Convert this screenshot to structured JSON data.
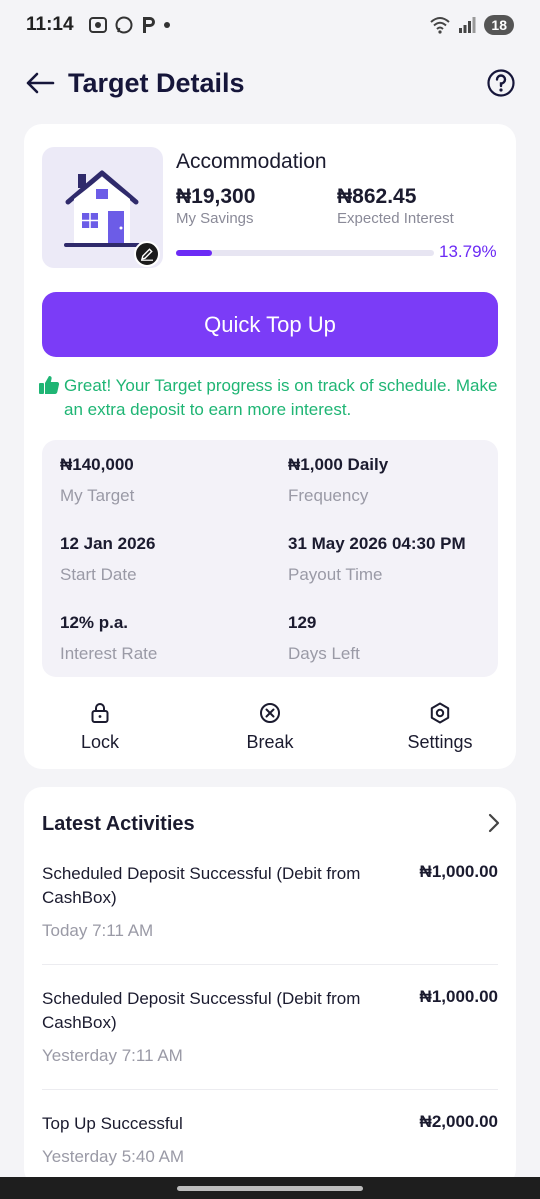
{
  "status_bar": {
    "time": "11:14",
    "battery": "18"
  },
  "header": {
    "title": "Target Details"
  },
  "target": {
    "name": "Accommodation",
    "savings": "₦19,300",
    "savings_label": "My Savings",
    "interest": "₦862.45",
    "interest_label": "Expected Interest",
    "progress_percent": "13.79%",
    "progress_value": 13.79
  },
  "quick_top_up_label": "Quick Top Up",
  "track_message": "Great! Your Target progress is on track of schedule. Make an extra deposit to earn more interest.",
  "details": {
    "target": {
      "value": "₦140,000",
      "label": "My Target"
    },
    "frequency": {
      "value": "₦1,000 Daily",
      "label": "Frequency"
    },
    "start_date": {
      "value": "12 Jan 2026",
      "label": "Start Date"
    },
    "payout_time": {
      "value": "31 May 2026 04:30 PM",
      "label": "Payout Time"
    },
    "interest_rate": {
      "value": "12% p.a.",
      "label": "Interest Rate"
    },
    "days_left": {
      "value": "129",
      "label": "Days Left"
    }
  },
  "actions": {
    "lock": "Lock",
    "break": "Break",
    "settings": "Settings"
  },
  "activities": {
    "title": "Latest Activities",
    "items": [
      {
        "desc": "Scheduled Deposit Successful (Debit from CashBox)",
        "amount": "₦1,000.00",
        "time": "Today 7:11 AM"
      },
      {
        "desc": "Scheduled Deposit Successful (Debit from CashBox)",
        "amount": "₦1,000.00",
        "time": "Yesterday 7:11 AM"
      },
      {
        "desc": "Top Up Successful",
        "amount": "₦2,000.00",
        "time": "Yesterday 5:40 AM"
      }
    ]
  },
  "colors": {
    "accent": "#7B3CF7",
    "success": "#1FB574",
    "background": "#F4F4F7"
  },
  "icons": [
    "back-arrow-icon",
    "help-icon",
    "house-icon",
    "edit-icon",
    "thumbs-up-icon",
    "lock-icon",
    "break-icon",
    "settings-icon",
    "chevron-right-icon"
  ]
}
